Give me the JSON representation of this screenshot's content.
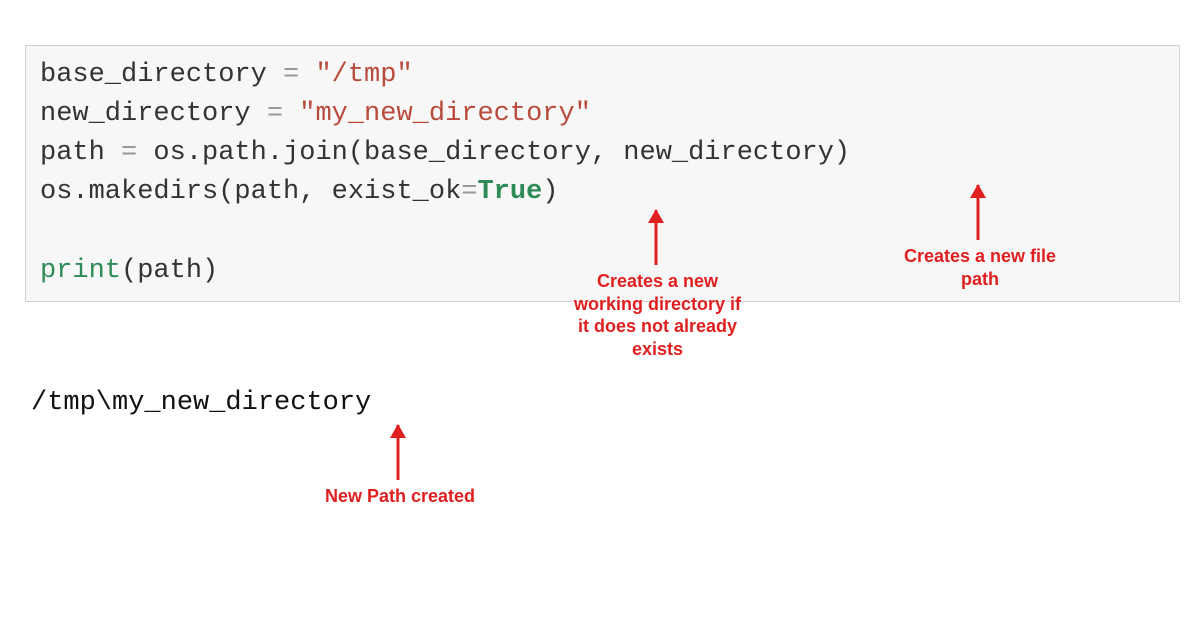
{
  "code": {
    "line1": {
      "var": "base_directory ",
      "op": "=",
      "str": " \"/tmp\""
    },
    "line2": {
      "var": "new_directory ",
      "op": "=",
      "str": " \"my_new_directory\""
    },
    "line3": {
      "var": "path ",
      "op": "=",
      "rest": " os.path.join(base_directory, new_directory)"
    },
    "line4": {
      "pre": "os.makedirs(path, exist_ok",
      "op": "=",
      "kw": "True",
      "post": ")"
    },
    "blank": "",
    "line6": {
      "call": "print",
      "rest": "(path)"
    }
  },
  "output": "/tmp\\my_new_directory",
  "annotations": {
    "makedirs": "Creates a new\nworking directory if\nit does not already\nexists",
    "newfilepath": "Creates a new file\npath",
    "newpath": "New Path created"
  },
  "colors": {
    "annotation": "#e02020",
    "code_bg": "#f7f7f7",
    "string": "#b84b3b",
    "keyword": "#2e8b57"
  }
}
